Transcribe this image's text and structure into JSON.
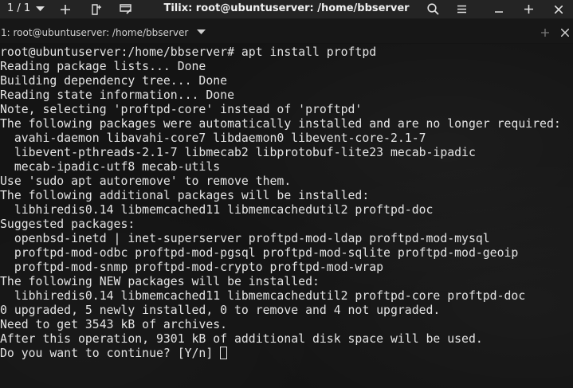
{
  "titlebar": {
    "session_count": "1 / 1",
    "title": "Tilix: root@ubuntuserver: /home/bbserver"
  },
  "tab": {
    "label": "1: root@ubuntuserver: /home/bbserver"
  },
  "terminal": {
    "lines": [
      "root@ubuntuserver:/home/bbserver# apt install proftpd",
      "Reading package lists... Done",
      "Building dependency tree... Done",
      "Reading state information... Done",
      "Note, selecting 'proftpd-core' instead of 'proftpd'",
      "The following packages were automatically installed and are no longer required:",
      "  avahi-daemon libavahi-core7 libdaemon0 libevent-core-2.1-7",
      "  libevent-pthreads-2.1-7 libmecab2 libprotobuf-lite23 mecab-ipadic",
      "  mecab-ipadic-utf8 mecab-utils",
      "Use 'sudo apt autoremove' to remove them.",
      "The following additional packages will be installed:",
      "  libhiredis0.14 libmemcached11 libmemcachedutil2 proftpd-doc",
      "Suggested packages:",
      "  openbsd-inetd | inet-superserver proftpd-mod-ldap proftpd-mod-mysql",
      "  proftpd-mod-odbc proftpd-mod-pgsql proftpd-mod-sqlite proftpd-mod-geoip",
      "  proftpd-mod-snmp proftpd-mod-crypto proftpd-mod-wrap",
      "The following NEW packages will be installed:",
      "  libhiredis0.14 libmemcached11 libmemcachedutil2 proftpd-core proftpd-doc",
      "0 upgraded, 5 newly installed, 0 to remove and 4 not upgraded.",
      "Need to get 3543 kB of archives.",
      "After this operation, 9301 kB of additional disk space will be used."
    ],
    "prompt_line": "Do you want to continue? [Y/n] "
  },
  "icons": {
    "session_dropdown": "chevron-down-icon",
    "add_terminal": "plus-icon",
    "split_vertical": "split-icon",
    "edit_session": "edit-window-icon",
    "search": "search-icon",
    "menu": "hamburger-icon",
    "minimize": "minimize-icon",
    "maximize": "maximize-icon",
    "close": "close-icon",
    "tab_dropdown": "chevron-down-icon",
    "tab_add": "plus-icon",
    "tab_close": "close-icon"
  }
}
